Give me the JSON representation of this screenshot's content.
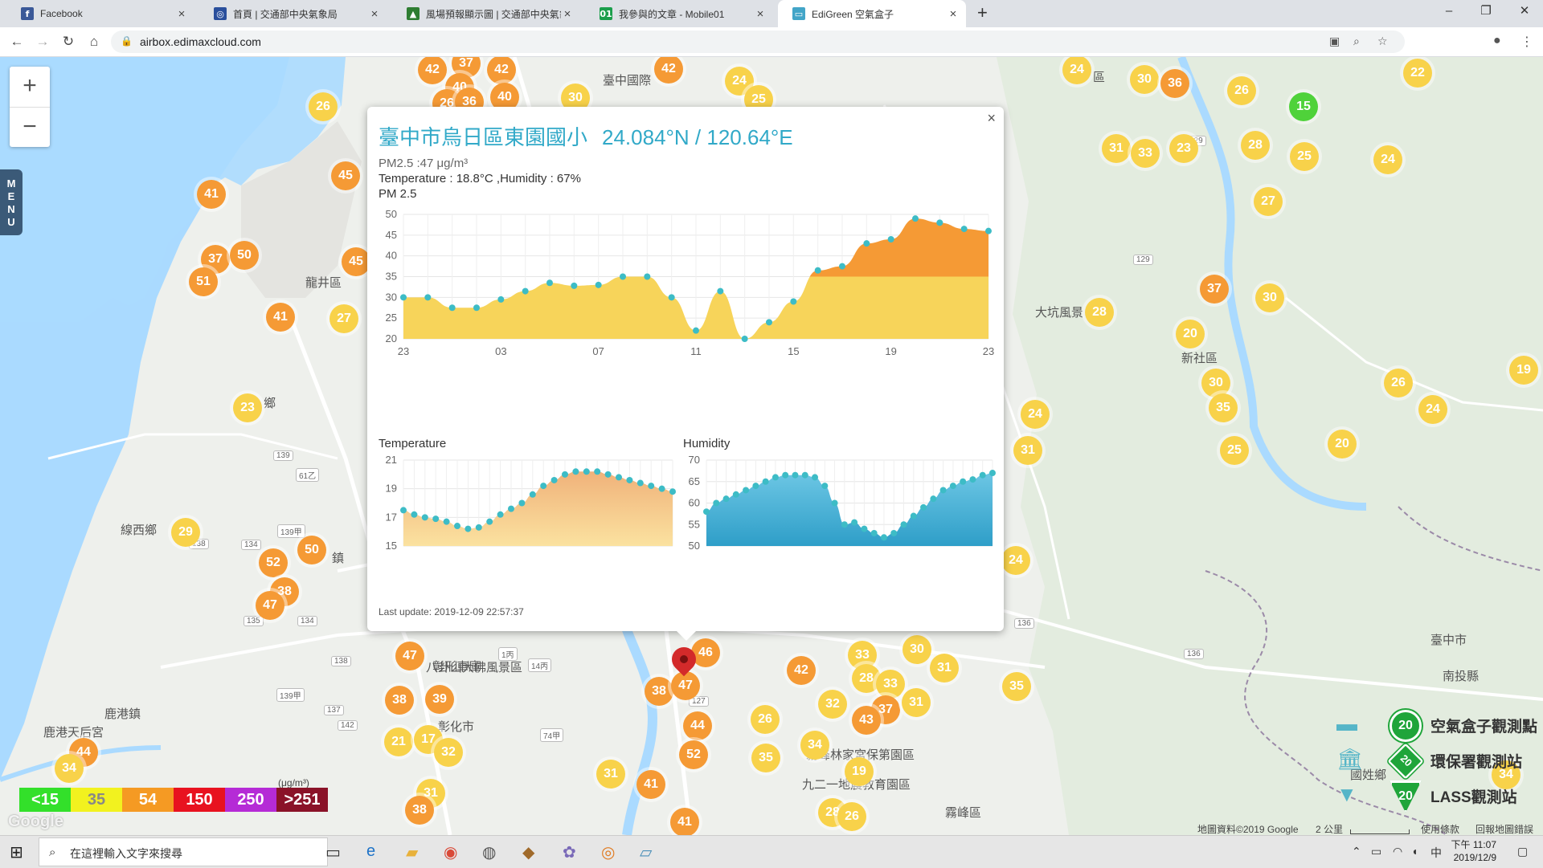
{
  "browser": {
    "tabs": [
      {
        "title": "Facebook",
        "icon": "facebook-icon",
        "color": "#3b5998",
        "glyph": "f"
      },
      {
        "title": "首頁 | 交通部中央氣象局",
        "icon": "weather-bureau-icon",
        "color": "#2a4f9c",
        "glyph": "◎"
      },
      {
        "title": "風場預報顯示圖 | 交通部中央氣象",
        "icon": "weather-map-icon",
        "color": "#2e7d32",
        "glyph": "▲"
      },
      {
        "title": "我參與的文章 - Mobile01",
        "icon": "mobile01-icon",
        "color": "#1b9e4b",
        "glyph": "01"
      },
      {
        "title": "EdiGreen 空氣盒子",
        "icon": "edigreen-icon",
        "color": "#42a5c8",
        "glyph": "▭"
      }
    ],
    "url": "airbox.edimaxcloud.com"
  },
  "map": {
    "menu_label": "MENU",
    "zoom_in": "+",
    "zoom_out": "−",
    "labels": [
      {
        "text": "臺中國際",
        "l": 750,
        "t": 18
      },
      {
        "text": "龍井區",
        "l": 380,
        "t": 270
      },
      {
        "text": "線西鄉",
        "l": 150,
        "t": 578
      },
      {
        "text": "鹿港鎮",
        "l": 130,
        "t": 807
      },
      {
        "text": "鹿港天后宮",
        "l": 54,
        "t": 830
      },
      {
        "text": "彰化市",
        "l": 545,
        "t": 823
      },
      {
        "text": "大坑風景",
        "l": 1288,
        "t": 307
      },
      {
        "text": "新社區",
        "l": 1470,
        "t": 364
      },
      {
        "text": "霧峰區",
        "l": 1176,
        "t": 930
      },
      {
        "text": "國姓鄉",
        "l": 1680,
        "t": 883
      },
      {
        "text": "八卦山大佛風景區",
        "l": 530,
        "t": 749
      },
      {
        "text": "霧峰林家宮保第園區",
        "l": 1003,
        "t": 858
      },
      {
        "text": "九二一地震教育園區",
        "l": 998,
        "t": 895
      },
      {
        "text": "區",
        "l": 1360,
        "t": 14
      },
      {
        "text": "鄉",
        "l": 328,
        "t": 420
      },
      {
        "text": "鎮",
        "l": 413,
        "t": 613
      },
      {
        "text": "臺中市",
        "l": 1780,
        "t": 715
      },
      {
        "text": "南投縣",
        "l": 1795,
        "t": 760
      },
      {
        "text": "彰形車庫",
        "l": 538,
        "t": 748
      }
    ],
    "roads": [
      {
        "text": "129",
        "l": 1476,
        "t": 98
      },
      {
        "text": "129",
        "l": 1410,
        "t": 246
      },
      {
        "text": "139",
        "l": 340,
        "t": 490
      },
      {
        "text": "61乙",
        "l": 368,
        "t": 512
      },
      {
        "text": "139甲",
        "l": 345,
        "t": 582
      },
      {
        "text": "134",
        "l": 300,
        "t": 601
      },
      {
        "text": "135",
        "l": 303,
        "t": 696
      },
      {
        "text": "134",
        "l": 370,
        "t": 696
      },
      {
        "text": "138",
        "l": 412,
        "t": 746
      },
      {
        "text": "139甲",
        "l": 344,
        "t": 786
      },
      {
        "text": "137",
        "l": 403,
        "t": 807
      },
      {
        "text": "142",
        "l": 420,
        "t": 826
      },
      {
        "text": "127",
        "l": 857,
        "t": 796
      },
      {
        "text": "74甲",
        "l": 672,
        "t": 836
      },
      {
        "text": "14丙",
        "l": 657,
        "t": 749
      },
      {
        "text": "1丙",
        "l": 620,
        "t": 735
      },
      {
        "text": "136",
        "l": 1262,
        "t": 699
      },
      {
        "text": "136",
        "l": 1473,
        "t": 737
      },
      {
        "text": "138",
        "l": 235,
        "t": 600
      }
    ],
    "markers": [
      {
        "v": "42",
        "c": "o",
        "x": 538,
        "y": 16
      },
      {
        "v": "37",
        "c": "o",
        "x": 580,
        "y": 8
      },
      {
        "v": "42",
        "c": "o",
        "x": 624,
        "y": 16
      },
      {
        "v": "42",
        "c": "o",
        "x": 832,
        "y": 15
      },
      {
        "v": "24",
        "c": "y",
        "x": 920,
        "y": 30
      },
      {
        "v": "26",
        "c": "y",
        "x": 402,
        "y": 62
      },
      {
        "v": "40",
        "c": "o",
        "x": 572,
        "y": 38
      },
      {
        "v": "26",
        "c": "o",
        "x": 556,
        "y": 58
      },
      {
        "v": "36",
        "c": "o",
        "x": 584,
        "y": 56
      },
      {
        "v": "40",
        "c": "o",
        "x": 628,
        "y": 50
      },
      {
        "v": "30",
        "c": "y",
        "x": 716,
        "y": 51
      },
      {
        "v": "25",
        "c": "y",
        "x": 944,
        "y": 53
      },
      {
        "v": "45",
        "c": "o",
        "x": 430,
        "y": 148
      },
      {
        "v": "41",
        "c": "o",
        "x": 263,
        "y": 171
      },
      {
        "v": "37",
        "c": "o",
        "x": 268,
        "y": 252
      },
      {
        "v": "50",
        "c": "o",
        "x": 304,
        "y": 247
      },
      {
        "v": "51",
        "c": "o",
        "x": 253,
        "y": 280
      },
      {
        "v": "45",
        "c": "o",
        "x": 443,
        "y": 255
      },
      {
        "v": "41",
        "c": "o",
        "x": 349,
        "y": 324
      },
      {
        "v": "27",
        "c": "y",
        "x": 428,
        "y": 326
      },
      {
        "v": "23",
        "c": "y",
        "x": 308,
        "y": 437
      },
      {
        "v": "29",
        "c": "y",
        "x": 231,
        "y": 592
      },
      {
        "v": "50",
        "c": "o",
        "x": 388,
        "y": 614
      },
      {
        "v": "52",
        "c": "o",
        "x": 340,
        "y": 630
      },
      {
        "v": "38",
        "c": "o",
        "x": 354,
        "y": 666
      },
      {
        "v": "47",
        "c": "o",
        "x": 336,
        "y": 683
      },
      {
        "v": "47",
        "c": "o",
        "x": 510,
        "y": 746
      },
      {
        "v": "38",
        "c": "o",
        "x": 497,
        "y": 801
      },
      {
        "v": "39",
        "c": "o",
        "x": 547,
        "y": 800
      },
      {
        "v": "21",
        "c": "y",
        "x": 496,
        "y": 853
      },
      {
        "v": "17",
        "c": "y",
        "x": 533,
        "y": 850
      },
      {
        "v": "32",
        "c": "y",
        "x": 558,
        "y": 866
      },
      {
        "v": "31",
        "c": "y",
        "x": 536,
        "y": 917
      },
      {
        "v": "38",
        "c": "o",
        "x": 522,
        "y": 938
      },
      {
        "v": "44",
        "c": "o",
        "x": 104,
        "y": 866
      },
      {
        "v": "34",
        "c": "y",
        "x": 86,
        "y": 886
      },
      {
        "v": "46",
        "c": "o",
        "x": 878,
        "y": 742
      },
      {
        "v": "38",
        "c": "o",
        "x": 820,
        "y": 790
      },
      {
        "v": "47",
        "c": "o",
        "x": 853,
        "y": 783
      },
      {
        "v": "44",
        "c": "o",
        "x": 868,
        "y": 833
      },
      {
        "v": "52",
        "c": "o",
        "x": 863,
        "y": 869
      },
      {
        "v": "31",
        "c": "y",
        "x": 760,
        "y": 893
      },
      {
        "v": "41",
        "c": "o",
        "x": 810,
        "y": 906
      },
      {
        "v": "41",
        "c": "o",
        "x": 852,
        "y": 953
      },
      {
        "v": "26",
        "c": "y",
        "x": 952,
        "y": 825
      },
      {
        "v": "35",
        "c": "y",
        "x": 953,
        "y": 873
      },
      {
        "v": "34",
        "c": "y",
        "x": 1014,
        "y": 857
      },
      {
        "v": "42",
        "c": "o",
        "x": 997,
        "y": 764
      },
      {
        "v": "33",
        "c": "y",
        "x": 1073,
        "y": 745
      },
      {
        "v": "28",
        "c": "y",
        "x": 1078,
        "y": 774
      },
      {
        "v": "33",
        "c": "y",
        "x": 1108,
        "y": 781
      },
      {
        "v": "37",
        "c": "o",
        "x": 1102,
        "y": 813
      },
      {
        "v": "32",
        "c": "y",
        "x": 1036,
        "y": 806
      },
      {
        "v": "43",
        "c": "o",
        "x": 1078,
        "y": 826
      },
      {
        "v": "30",
        "c": "y",
        "x": 1141,
        "y": 738
      },
      {
        "v": "31",
        "c": "y",
        "x": 1175,
        "y": 761
      },
      {
        "v": "31",
        "c": "y",
        "x": 1140,
        "y": 804
      },
      {
        "v": "35",
        "c": "y",
        "x": 1265,
        "y": 784
      },
      {
        "v": "19",
        "c": "y",
        "x": 1069,
        "y": 890
      },
      {
        "v": "28",
        "c": "y",
        "x": 1036,
        "y": 941
      },
      {
        "v": "26",
        "c": "y",
        "x": 1060,
        "y": 946
      },
      {
        "v": "24",
        "c": "y",
        "x": 1340,
        "y": 16
      },
      {
        "v": "30",
        "c": "y",
        "x": 1424,
        "y": 28
      },
      {
        "v": "36",
        "c": "o",
        "x": 1462,
        "y": 33
      },
      {
        "v": "22",
        "c": "y",
        "x": 1764,
        "y": 20
      },
      {
        "v": "26",
        "c": "y",
        "x": 1545,
        "y": 42
      },
      {
        "v": "15",
        "c": "g",
        "x": 1622,
        "y": 62
      },
      {
        "v": "31",
        "c": "y",
        "x": 1389,
        "y": 114
      },
      {
        "v": "33",
        "c": "y",
        "x": 1425,
        "y": 120
      },
      {
        "v": "23",
        "c": "y",
        "x": 1473,
        "y": 114
      },
      {
        "v": "28",
        "c": "y",
        "x": 1562,
        "y": 110
      },
      {
        "v": "25",
        "c": "y",
        "x": 1623,
        "y": 124
      },
      {
        "v": "24",
        "c": "y",
        "x": 1727,
        "y": 128
      },
      {
        "v": "27",
        "c": "y",
        "x": 1578,
        "y": 180
      },
      {
        "v": "37",
        "c": "o",
        "x": 1511,
        "y": 289
      },
      {
        "v": "30",
        "c": "y",
        "x": 1580,
        "y": 300
      },
      {
        "v": "28",
        "c": "y",
        "x": 1368,
        "y": 318
      },
      {
        "v": "20",
        "c": "y",
        "x": 1481,
        "y": 345
      },
      {
        "v": "30",
        "c": "y",
        "x": 1513,
        "y": 406
      },
      {
        "v": "26",
        "c": "y",
        "x": 1740,
        "y": 406
      },
      {
        "v": "35",
        "c": "y",
        "x": 1522,
        "y": 437
      },
      {
        "v": "24",
        "c": "y",
        "x": 1783,
        "y": 439
      },
      {
        "v": "19",
        "c": "y",
        "x": 1896,
        "y": 390
      },
      {
        "v": "24",
        "c": "y",
        "x": 1288,
        "y": 445
      },
      {
        "v": "31",
        "c": "y",
        "x": 1279,
        "y": 490
      },
      {
        "v": "25",
        "c": "y",
        "x": 1536,
        "y": 490
      },
      {
        "v": "20",
        "c": "y",
        "x": 1670,
        "y": 482
      },
      {
        "v": "24",
        "c": "y",
        "x": 1264,
        "y": 627
      },
      {
        "v": "34",
        "c": "y",
        "x": 1874,
        "y": 894
      }
    ],
    "aqi_scale": [
      {
        "label": "<15",
        "color": "#33e02a"
      },
      {
        "label": "35",
        "color": "#f2f21f"
      },
      {
        "label": "54",
        "color": "#f59a23"
      },
      {
        "label": "150",
        "color": "#e8121f"
      },
      {
        "label": "250",
        "color": "#b52bd6"
      },
      {
        "label": ">251",
        "color": "#8a1228"
      }
    ],
    "unit": "(μg/m³)",
    "legend": [
      {
        "label": "空氣盒子觀測點",
        "value": "20",
        "icon": "airbox-icon"
      },
      {
        "label": "環保署觀測站",
        "value": "20",
        "icon": "epa-station-icon"
      },
      {
        "label": "LASS觀測站",
        "value": "20",
        "icon": "lass-station-icon"
      }
    ],
    "google_logo": "Google",
    "credits": {
      "data": "地圖資料©2019 Google",
      "scale": "2 公里",
      "terms": "使用條款",
      "report": "回報地圖錯誤"
    }
  },
  "popup": {
    "station": "臺中市烏日區東園國小",
    "coords": "24.084°N / 120.64°E",
    "pm_line": "PM2.5 :47 μg/m³",
    "env_line": "Temperature : 18.8°C ,Humidity : 67%",
    "chart_title": "PM 2.5",
    "temp_title": "Temperature",
    "hum_title": "Humidity",
    "last_update": "Last update: 2019-12-09 22:57:37",
    "close": "×"
  },
  "chart_data": [
    {
      "type": "area",
      "title": "PM 2.5",
      "x_ticks": [
        "23",
        "03",
        "07",
        "11",
        "15",
        "19",
        "23"
      ],
      "ylim": [
        20,
        50
      ],
      "y_ticks": [
        20,
        25,
        30,
        35,
        40,
        45,
        50
      ],
      "threshold": 35,
      "colors": {
        "low": "#f7d45a",
        "high": "#f59a35",
        "point": "#3dbcc6"
      },
      "values": [
        30,
        30,
        27.5,
        27.5,
        29.5,
        31.5,
        33.5,
        32.8,
        33,
        35,
        35,
        30,
        22,
        31.5,
        20,
        24,
        29,
        36.5,
        37.5,
        43,
        44,
        49,
        48,
        46.5,
        46
      ]
    },
    {
      "type": "area",
      "title": "Temperature",
      "ylim": [
        15,
        21
      ],
      "y_ticks": [
        15,
        17,
        19,
        21
      ],
      "colors": {
        "top": "#f0b27a",
        "bottom": "#fbe2a0",
        "point": "#3dbcc6"
      },
      "values": [
        17.5,
        17.2,
        17.0,
        16.9,
        16.7,
        16.4,
        16.2,
        16.3,
        16.7,
        17.2,
        17.6,
        18.0,
        18.6,
        19.2,
        19.6,
        20.0,
        20.2,
        20.2,
        20.2,
        20.0,
        19.8,
        19.6,
        19.4,
        19.2,
        19.0,
        18.8
      ]
    },
    {
      "type": "area",
      "title": "Humidity",
      "ylim": [
        50,
        70
      ],
      "y_ticks": [
        50,
        55,
        60,
        65,
        70
      ],
      "colors": {
        "top": "#6cc6e4",
        "bottom": "#2e9ec8",
        "point": "#3dbcc6"
      },
      "values": [
        58,
        60,
        61,
        62,
        63,
        64,
        65,
        66,
        66.5,
        66.5,
        66.5,
        66,
        64,
        60,
        55,
        55.5,
        54,
        53,
        52,
        53,
        55,
        57,
        59,
        61,
        63,
        64,
        65,
        65.5,
        66.5,
        67
      ]
    }
  ],
  "taskbar": {
    "search_placeholder": "在這裡輸入文字來搜尋",
    "time": "下午 11:07",
    "date": "2019/12/9",
    "ime": "中"
  }
}
